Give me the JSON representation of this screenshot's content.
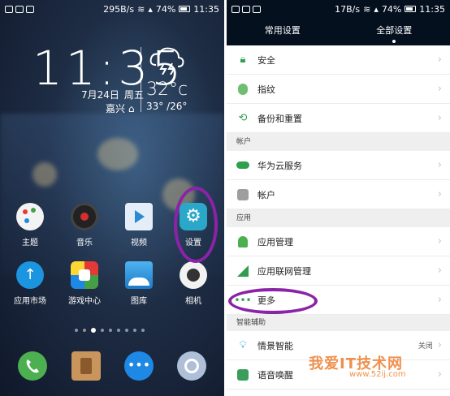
{
  "left": {
    "status": {
      "speed": "295B/s",
      "battery": "74%",
      "time": "11:35"
    },
    "clock": "11:35",
    "date": {
      "day": "7月24日",
      "weekday": "周五"
    },
    "location": "嘉兴",
    "temp": "32°c",
    "range": "33° /26°",
    "apps": [
      {
        "label": "主题"
      },
      {
        "label": "音乐"
      },
      {
        "label": "视频"
      },
      {
        "label": "设置"
      },
      {
        "label": "应用市场"
      },
      {
        "label": "游戏中心"
      },
      {
        "label": "图库"
      },
      {
        "label": "相机"
      }
    ]
  },
  "right": {
    "status": {
      "speed": "17B/s",
      "battery": "74%",
      "time": "11:35"
    },
    "tabs": [
      "常用设置",
      "全部设置"
    ],
    "rows": [
      {
        "label": "安全",
        "icon": "lock-icon"
      },
      {
        "label": "指纹",
        "icon": "fingerprint-icon"
      },
      {
        "label": "备份和重置",
        "icon": "backup-icon"
      }
    ],
    "section_account": "帐户",
    "account_rows": [
      {
        "label": "华为云服务",
        "icon": "cloud-icon"
      },
      {
        "label": "帐户",
        "icon": "user-icon"
      }
    ],
    "section_apps": "应用",
    "app_rows": [
      {
        "label": "应用管理",
        "icon": "android-icon"
      },
      {
        "label": "应用联网管理",
        "icon": "signal-icon"
      },
      {
        "label": "更多",
        "icon": "more-icon"
      }
    ],
    "section_assist": "智能辅助",
    "assist_rows": [
      {
        "label": "情景智能",
        "icon": "bulb-icon",
        "value": "关闭"
      },
      {
        "label": "语音唤醒",
        "icon": "voice-icon"
      }
    ]
  },
  "watermark": {
    "title": "我爱IT技术网",
    "url": "www.52ij.com"
  }
}
